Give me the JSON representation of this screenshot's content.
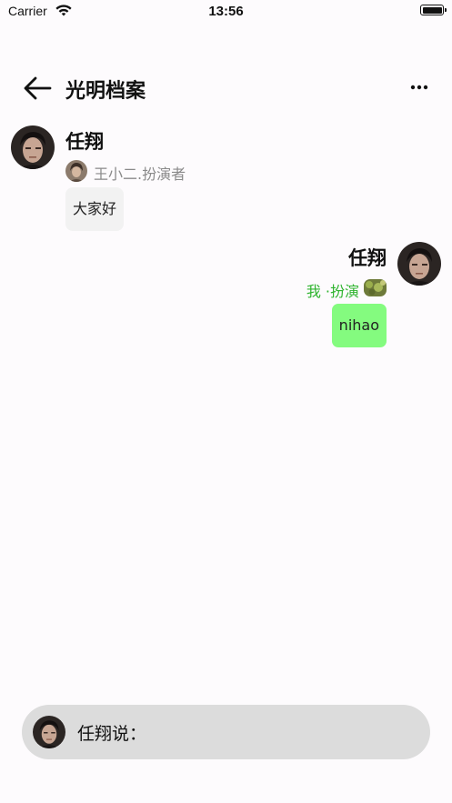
{
  "status_bar": {
    "carrier": "Carrier",
    "time": "13:56",
    "battery_level": 1.0
  },
  "header": {
    "title": "光明档案",
    "back_icon": "arrow-left-icon",
    "more_icon": "more-horizontal-icon"
  },
  "messages": [
    {
      "side": "left",
      "name": "任翔",
      "role": "王小二.扮演者",
      "text": "大家好"
    },
    {
      "side": "right",
      "name": "任翔",
      "role": "我 ·扮演",
      "text": "nihao"
    }
  ],
  "composer": {
    "placeholder": "任翔说："
  },
  "colors": {
    "background": "#fdfbfd",
    "my_bubble": "#84fb7f",
    "other_bubble": "#f2f2f2",
    "my_role_text": "#2fb42f",
    "other_role_text": "#8a8a8a",
    "composer": "#dcdcdc"
  }
}
